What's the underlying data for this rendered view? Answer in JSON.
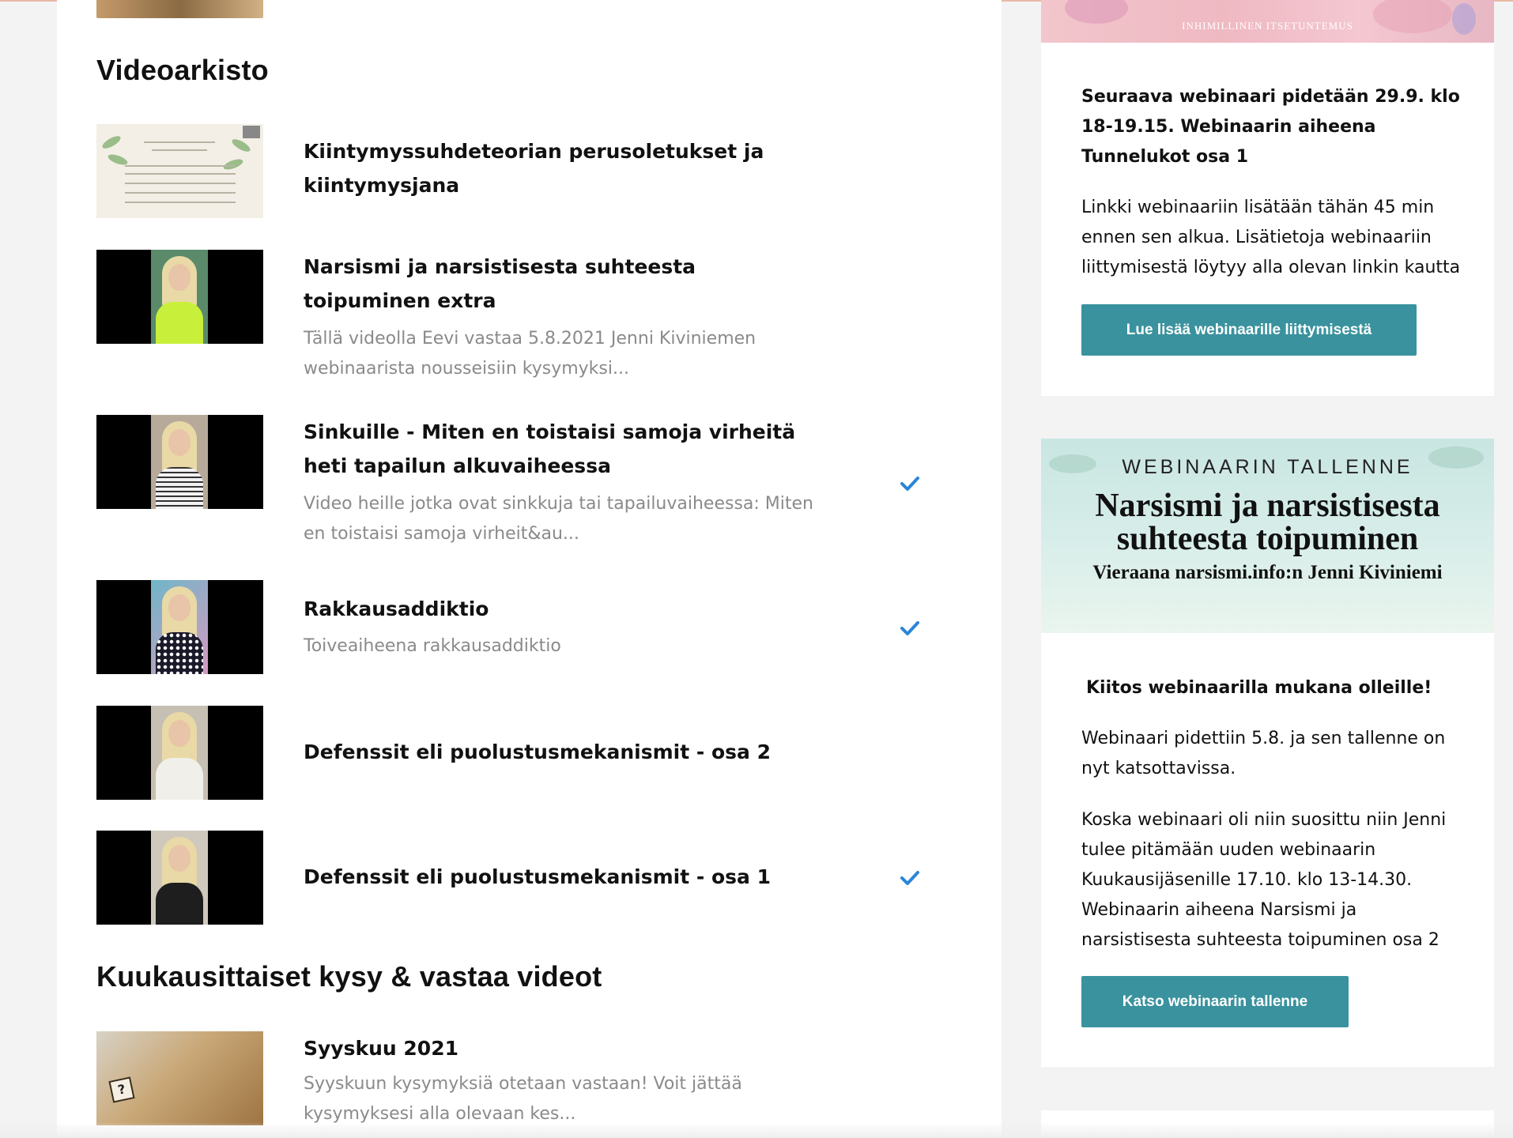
{
  "section_titles": {
    "archive": "Videoarkisto",
    "monthly": "Kuukausittaiset kysy & vastaa videot"
  },
  "videos": [
    {
      "title": "Kiintymyssuhdeteorian perusoletukset ja kiintymysjana",
      "desc": "",
      "watched": false,
      "thumb_icon": "slide-thumbnail"
    },
    {
      "title": "Narsismi ja narsistisesta suhteesta toipuminen extra",
      "desc": "Tällä videolla Eevi vastaa 5.8.2021 Jenni Kiviniemen webinaarista nousseisiin kysymyksi...",
      "watched": false,
      "thumb_icon": "video-thumbnail"
    },
    {
      "title": "Sinkuille - Miten en toistaisi samoja virheitä heti tapailun alkuvaiheessa",
      "desc": "Video heille jotka ovat sinkkuja tai tapailuvaiheessa:  Miten en toistaisi samoja virheit&au...",
      "watched": true,
      "thumb_icon": "video-thumbnail"
    },
    {
      "title": "Rakkausaddiktio",
      "desc": "Toiveaiheena rakkausaddiktio",
      "watched": true,
      "thumb_icon": "video-thumbnail"
    },
    {
      "title": "Defenssit eli puolustusmekanismit - osa 2",
      "desc": "",
      "watched": false,
      "thumb_icon": "video-thumbnail"
    },
    {
      "title": "Defenssit eli puolustusmekanismit - osa 1",
      "desc": "",
      "watched": true,
      "thumb_icon": "video-thumbnail"
    }
  ],
  "monthly_videos": [
    {
      "title": "Syyskuu 2021",
      "desc": "Syyskuun kysymyksiä otetaan vastaan! Voit jättää kysymyksesi alla olevaan kes...",
      "thumb_icon": "dice-thumbnail"
    }
  ],
  "sidebar": {
    "banner1_caption": "INHIMILLINEN ITSETUNTEMUS",
    "next_webinar_bold": "Seuraava webinaari pidetään 29.9. klo 18-19.15. Webinaarin aiheena Tunnelukot osa 1",
    "next_webinar_text": "Linkki webinaariin lisätään tähän 45 min ennen sen alkua. Lisätietoja webinaariin liittymisestä löytyy alla olevan linkin kautta",
    "join_button": "Lue lisää webinaarille liittymisestä",
    "banner2_kicker": "WEBINAARIN TALLENNE",
    "banner2_headline": "Narsismi ja narsistisesta suhteesta toipuminen",
    "banner2_sub": "Vieraana narsismi.info:n Jenni Kiviniemi",
    "thanks_bold": "Kiitos webinaarilla mukana olleille!",
    "recorded_text": "Webinaari pidettiin 5.8. ja sen tallenne on nyt katsottavissa.",
    "new_webinar_text": "Koska webinaari oli niin suosittu niin Jenni tulee pitämään uuden webinaarin Kuukausijäsenille 17.10. klo 13-14.30. Webinaarin aiheena Narsismi ja narsistisesta suhteesta toipuminen osa 2",
    "watch_button": "Katso webinaarin tallenne"
  },
  "colors": {
    "button": "#3a929e",
    "check": "#2b86d9",
    "muted_text": "#8a8a8a"
  }
}
